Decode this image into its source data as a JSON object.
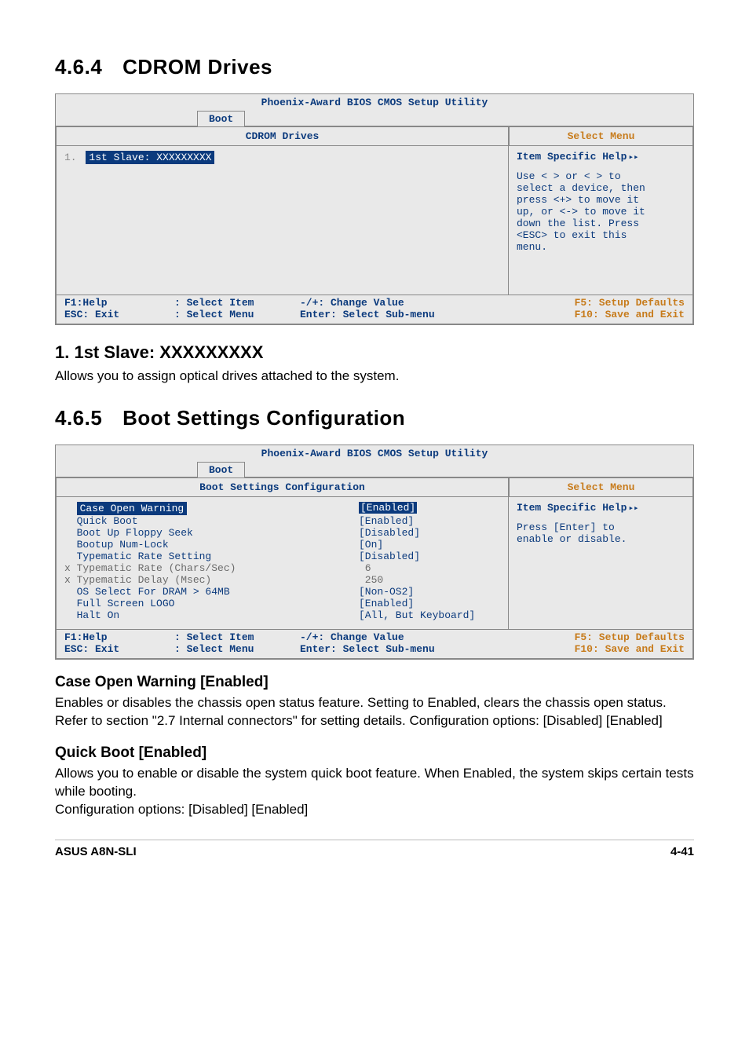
{
  "section464": {
    "num": "4.6.4",
    "title": "CDROM Drives"
  },
  "bios1": {
    "utility": "Phoenix-Award BIOS CMOS Setup Utility",
    "tab": "Boot",
    "left_header": "CDROM Drives",
    "right_header": "Select Menu",
    "row_prefix": "1.",
    "row_text": "1st Slave: XXXXXXXXX",
    "help_head": "Item Specific Help",
    "help_body": "Use < > or < > to\nselect a device, then\npress <+> to move it\nup, or <-> to move it\ndown the list. Press\n<ESC> to exit this\nmenu.",
    "footer": {
      "c1a": "F1:Help",
      "c1b": "ESC: Exit",
      "c2a": ": Select Item",
      "c2b": ": Select Menu",
      "c3a": "-/+: Change Value",
      "c3b": "Enter: Select Sub-menu",
      "c4a": "F5: Setup Defaults",
      "c4b": "F10: Save and Exit"
    }
  },
  "slave": {
    "heading": "1. 1st Slave: XXXXXXXXX",
    "body": "Allows you to assign optical drives attached to the system."
  },
  "section465": {
    "num": "4.6.5",
    "title": "Boot Settings Configuration"
  },
  "bios2": {
    "utility": "Phoenix-Award BIOS CMOS Setup Utility",
    "tab": "Boot",
    "left_header": "Boot Settings Configuration",
    "right_header": "Select Menu",
    "rows": [
      {
        "label": "  Case Open Warning",
        "value": "[Enabled]",
        "selLabel": true,
        "selVal": true
      },
      {
        "label": "  Quick Boot",
        "value": "[Enabled]"
      },
      {
        "label": "  Boot Up Floppy Seek",
        "value": "[Disabled]"
      },
      {
        "label": "  Bootup Num-Lock",
        "value": "[On]"
      },
      {
        "label": "  Typematic Rate Setting",
        "value": "[Disabled]"
      },
      {
        "label": "x Typematic Rate (Chars/Sec)",
        "value": " 6",
        "gray": true
      },
      {
        "label": "x Typematic Delay (Msec)",
        "value": " 250",
        "gray": true
      },
      {
        "label": "  OS Select For DRAM > 64MB",
        "value": "[Non-OS2]"
      },
      {
        "label": "  Full Screen LOGO",
        "value": "[Enabled]"
      },
      {
        "label": "  Halt On",
        "value": "[All, But Keyboard]"
      }
    ],
    "help_head": "Item Specific Help",
    "help_body": "Press [Enter] to\nenable or disable.",
    "footer": {
      "c1a": "F1:Help",
      "c1b": "ESC: Exit",
      "c2a": ": Select Item",
      "c2b": ": Select Menu",
      "c3a": "-/+: Change Value",
      "c3b": "Enter: Select Sub-menu",
      "c4a": "F5: Setup Defaults",
      "c4b": "F10: Save and Exit"
    }
  },
  "caseOpen": {
    "heading": "Case Open Warning [Enabled]",
    "body": "Enables or disables the chassis open status feature. Setting to Enabled, clears the chassis open status. Refer to section \"2.7 Internal connectors\" for setting details. Configuration options: [Disabled] [Enabled]"
  },
  "quickBoot": {
    "heading": "Quick Boot [Enabled]",
    "body": "Allows you to enable or disable the system quick boot feature. When Enabled, the system skips certain tests while booting.\nConfiguration options: [Disabled] [Enabled]"
  },
  "footer": {
    "left": "ASUS A8N-SLI",
    "right": "4-41"
  }
}
